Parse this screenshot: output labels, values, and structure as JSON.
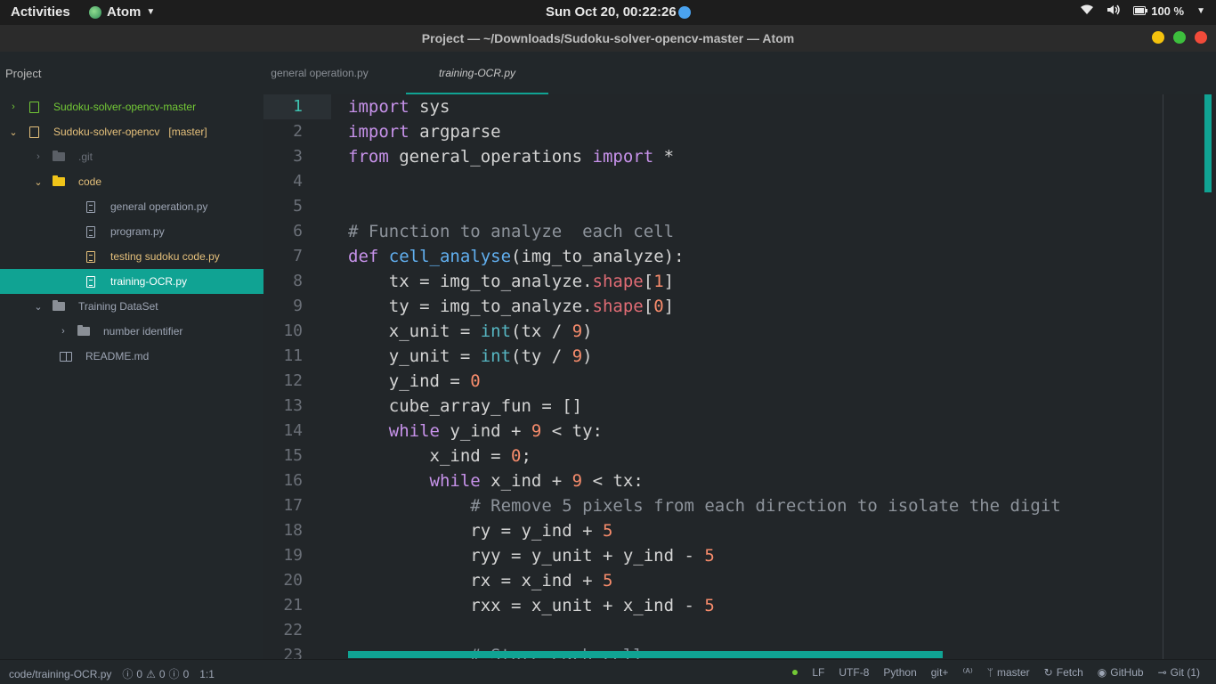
{
  "topbar": {
    "activities": "Activities",
    "app_name": "Atom",
    "clock": "Sun Oct 20, 00:22:26",
    "battery": "100 %"
  },
  "window": {
    "title": "Project — ~/Downloads/Sudoku-solver-opencv-master — Atom"
  },
  "tree": {
    "header": "Project",
    "items": [
      {
        "label": "Sudoku-solver-opencv-master",
        "chevron": "›"
      },
      {
        "label": "Sudoku-solver-opencv",
        "branch": "[master]",
        "chevron": "⌄"
      },
      {
        "label": ".git",
        "chevron": "›"
      },
      {
        "label": "code",
        "chevron": "⌄"
      },
      {
        "label": "general operation.py"
      },
      {
        "label": "program.py"
      },
      {
        "label": "testing sudoku code.py"
      },
      {
        "label": "training-OCR.py"
      },
      {
        "label": "Training DataSet",
        "chevron": "⌄"
      },
      {
        "label": "number identifier",
        "chevron": "›"
      },
      {
        "label": "README.md"
      }
    ]
  },
  "tabs": [
    {
      "label": "general operation.py"
    },
    {
      "label": "training-OCR.py"
    }
  ],
  "editor": {
    "line_numbers": [
      "1",
      "2",
      "3",
      "4",
      "5",
      "6",
      "7",
      "8",
      "9",
      "10",
      "11",
      "12",
      "13",
      "14",
      "15",
      "16",
      "17",
      "18",
      "19",
      "20",
      "21",
      "22",
      "23"
    ],
    "lines": {
      "l1_kw": "import",
      "l1_rest": " sys",
      "l2_kw": "import",
      "l2_rest": " argparse",
      "l3_kw": "from",
      "l3_mod": " general_operations ",
      "l3_kw2": "import",
      "l3_rest": " *",
      "l6": "# Function to analyze  each cell",
      "l7_kw": "def",
      "l7_fn": " cell_analyse",
      "l7_rest": "(img_to_analyze):",
      "l8_a": "    tx = img_to_analyze.",
      "l8_attr": "shape",
      "l8_b": "[",
      "l8_num": "1",
      "l8_c": "]",
      "l9_a": "    ty = img_to_analyze.",
      "l9_attr": "shape",
      "l9_b": "[",
      "l9_num": "0",
      "l9_c": "]",
      "l10_a": "    x_unit = ",
      "l10_bi": "int",
      "l10_b": "(tx / ",
      "l10_num": "9",
      "l10_c": ")",
      "l11_a": "    y_unit = ",
      "l11_bi": "int",
      "l11_b": "(ty / ",
      "l11_num": "9",
      "l11_c": ")",
      "l12_a": "    y_ind = ",
      "l12_num": "0",
      "l13": "    cube_array_fun = []",
      "l14_kw": "    while",
      "l14_a": " y_ind + ",
      "l14_num": "9",
      "l14_b": " < ty:",
      "l15_a": "        x_ind = ",
      "l15_num": "0",
      "l15_b": ";",
      "l16_kw": "        while",
      "l16_a": " x_ind + ",
      "l16_num": "9",
      "l16_b": " < tx:",
      "l17": "            # Remove 5 pixels from each direction to isolate the digit",
      "l18_a": "            ry = y_ind + ",
      "l18_num": "5",
      "l19_a": "            ryy = y_unit + y_ind - ",
      "l19_num": "5",
      "l20_a": "            rx = x_ind + ",
      "l20_num": "5",
      "l21_a": "            rxx = x_unit + x_ind - ",
      "l21_num": "5",
      "l23": "            # Store each cell"
    }
  },
  "statusbar": {
    "file_path": "code/training-OCR.py",
    "errors": "0",
    "warnings": "0",
    "infos": "0",
    "cursor": "1:1",
    "line_ending": "LF",
    "encoding": "UTF-8",
    "grammar": "Python",
    "git_plus": "git+",
    "branch": "master",
    "fetch": "Fetch",
    "github": "GitHub",
    "git": "Git (1)"
  }
}
